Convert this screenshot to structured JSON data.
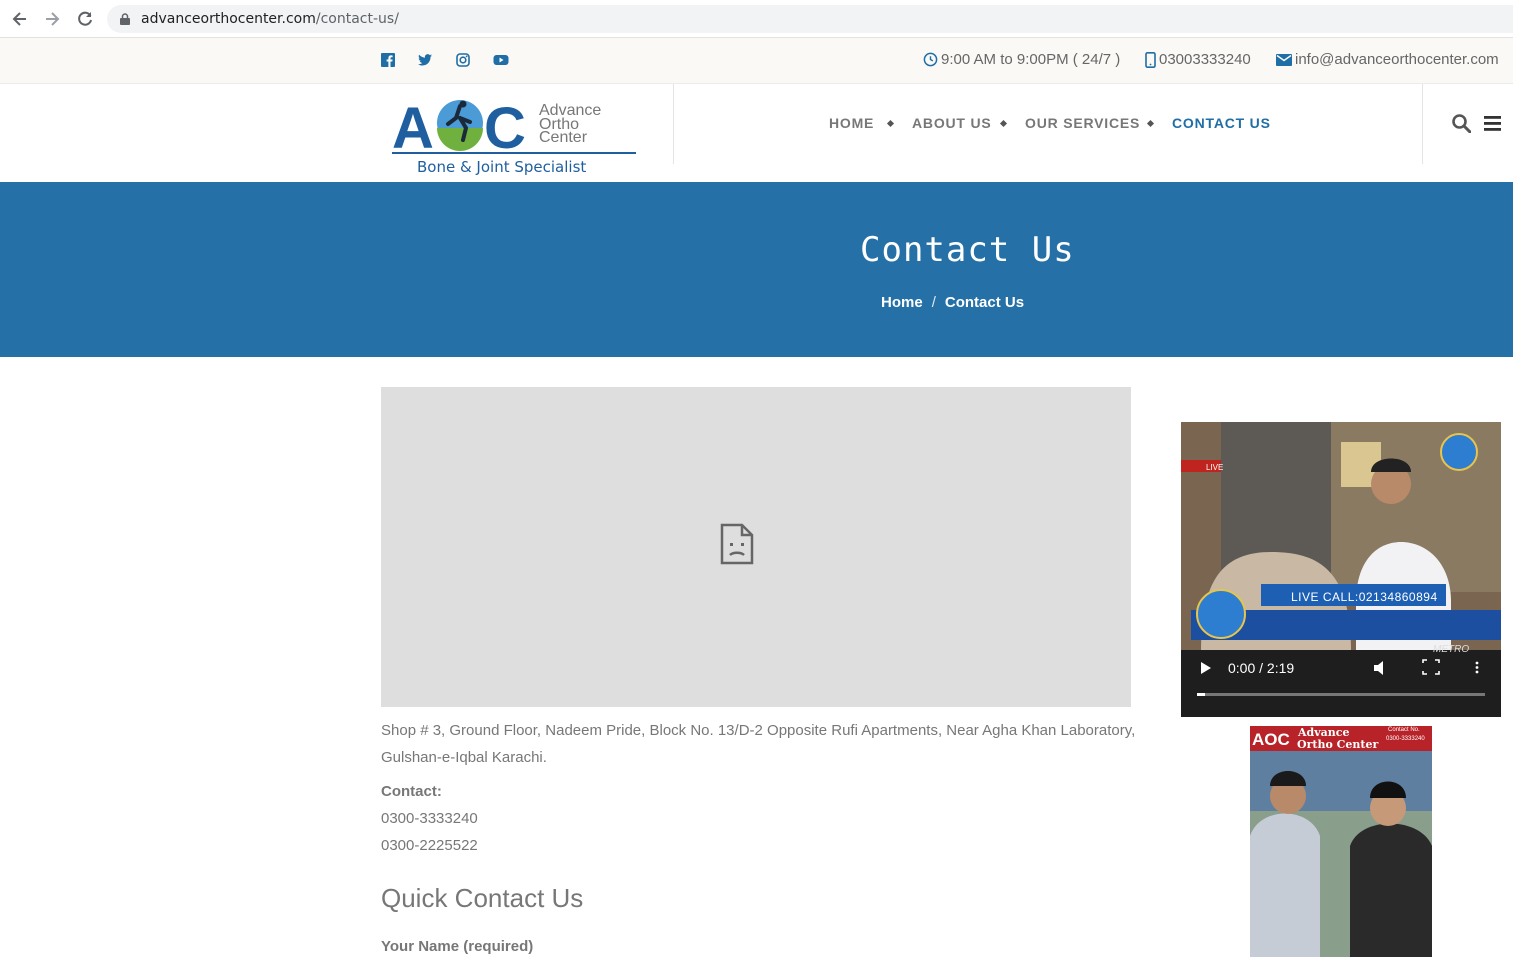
{
  "browser": {
    "url_domain": "advanceorthocenter.com",
    "url_path": "/contact-us/"
  },
  "topbar": {
    "social": [
      "facebook-icon",
      "twitter-icon",
      "instagram-icon",
      "youtube-icon"
    ],
    "hours": "9:00 AM to 9:00PM ( 24/7 )",
    "phone": "03003333240",
    "email": "info@advanceorthocenter.com"
  },
  "logo": {
    "letters": "AOC",
    "line1": "Advance",
    "line2": "Ortho",
    "line3": "Center",
    "tagline": "Bone & Joint Specialist"
  },
  "nav": {
    "home": "HOME",
    "about": "ABOUT US",
    "services": "OUR SERVICES",
    "contact": "CONTACT US"
  },
  "banner": {
    "title": "Contact Us",
    "crumb_home": "Home",
    "crumb_sep": "/",
    "crumb_current": "Contact Us"
  },
  "content": {
    "address": "Shop # 3, Ground Floor, Nadeem Pride, Block No. 13/D-2 Opposite Rufi Apartments, Near Agha Khan Laboratory, Gulshan-e-Iqbal Karachi.",
    "contact_label": "Contact:",
    "phone1": "0300-3333240",
    "phone2": "0300-2225522",
    "form_title": "Quick Contact Us",
    "name_label": "Your Name (required)"
  },
  "video": {
    "live_badge": "LIVE",
    "live_call": "LIVE CALL:02134860894",
    "time": "0:00 / 2:19",
    "channel": "METRO"
  },
  "poster": {
    "brand1": "Advance",
    "brand2": "Ortho Center",
    "contact_label": "Contact No.",
    "contact_num": "0300-3333240"
  },
  "colors": {
    "brand_blue": "#2570a6",
    "active_nav": "#1f6ea5"
  }
}
